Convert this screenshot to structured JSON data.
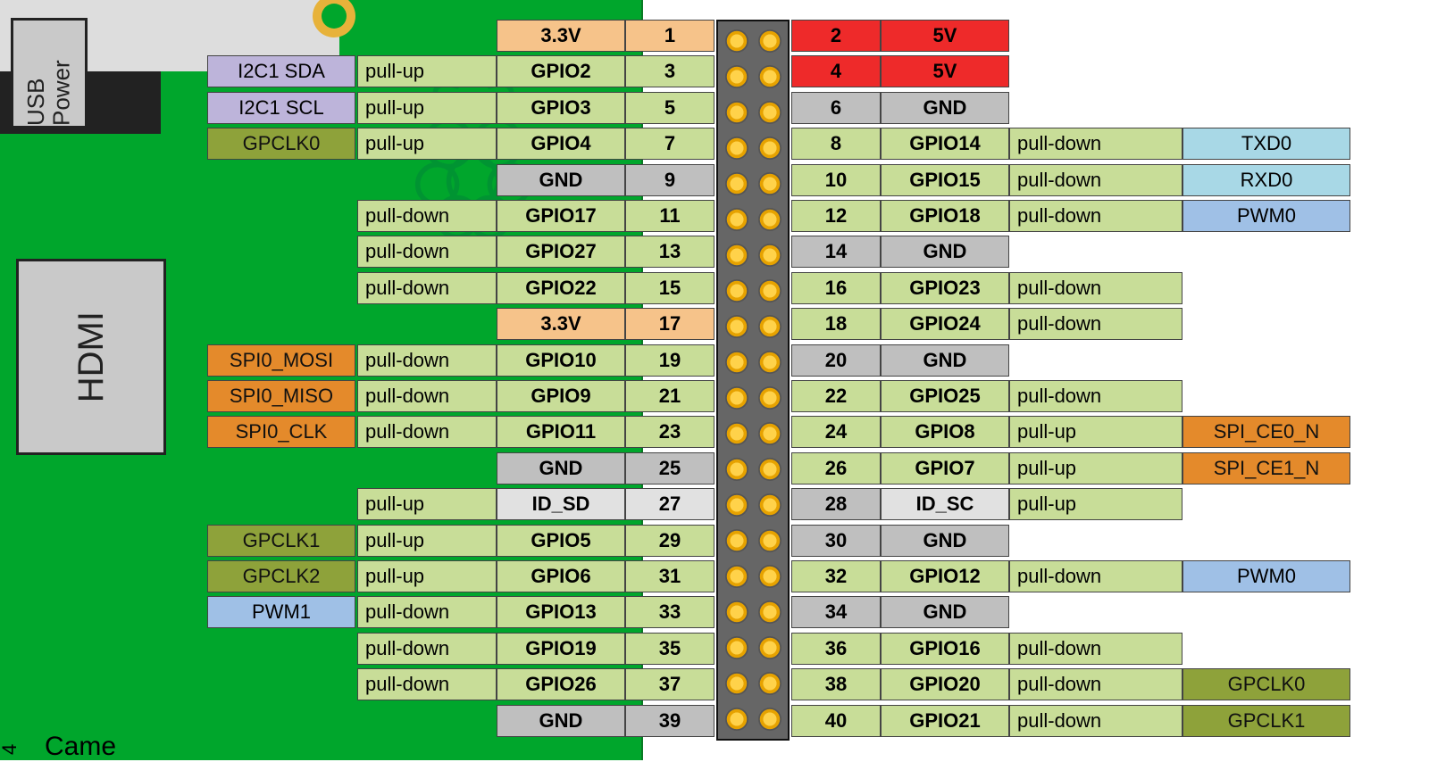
{
  "board": {
    "hdmi": "HDMI",
    "usb_power": "USB\nPower",
    "camera": "Came",
    "page_number": "4"
  },
  "colors": {
    "v33": "c-v33",
    "v5": "c-v5",
    "gnd": "c-gnd",
    "gpio": "c-gpio",
    "pull": "c-pull",
    "id": "c-id",
    "i2c": "c-i2c",
    "spi": "c-spi",
    "uart": "c-uart",
    "pwm": "c-pwm",
    "clk": "c-clk"
  },
  "rows": [
    {
      "l": {
        "num": "1",
        "name": "3.3V",
        "nameCls": "c-v33"
      },
      "r": {
        "num": "2",
        "name": "5V",
        "nameCls": "c-v5",
        "numCls": "c-v5"
      }
    },
    {
      "l": {
        "num": "3",
        "name": "GPIO2",
        "nameCls": "c-gpio",
        "pull": "pull-up",
        "alt": "I2C1 SDA",
        "altCls": "c-i2c"
      },
      "r": {
        "num": "4",
        "name": "5V",
        "nameCls": "c-v5",
        "numCls": "c-v5"
      }
    },
    {
      "l": {
        "num": "5",
        "name": "GPIO3",
        "nameCls": "c-gpio",
        "pull": "pull-up",
        "alt": "I2C1 SCL",
        "altCls": "c-i2c"
      },
      "r": {
        "num": "6",
        "name": "GND",
        "nameCls": "c-gnd",
        "numCls": "c-gnd"
      }
    },
    {
      "l": {
        "num": "7",
        "name": "GPIO4",
        "nameCls": "c-gpio",
        "pull": "pull-up",
        "alt": "GPCLK0",
        "altCls": "c-clk"
      },
      "r": {
        "num": "8",
        "name": "GPIO14",
        "nameCls": "c-gpio",
        "pull": "pull-down",
        "alt": "TXD0",
        "altCls": "c-uart"
      }
    },
    {
      "l": {
        "num": "9",
        "name": "GND",
        "nameCls": "c-gnd",
        "numCls": "c-gnd"
      },
      "r": {
        "num": "10",
        "name": "GPIO15",
        "nameCls": "c-gpio",
        "pull": "pull-down",
        "alt": "RXD0",
        "altCls": "c-uart"
      }
    },
    {
      "l": {
        "num": "11",
        "name": "GPIO17",
        "nameCls": "c-gpio",
        "pull": "pull-down"
      },
      "r": {
        "num": "12",
        "name": "GPIO18",
        "nameCls": "c-gpio",
        "pull": "pull-down",
        "alt": "PWM0",
        "altCls": "c-pwm"
      }
    },
    {
      "l": {
        "num": "13",
        "name": "GPIO27",
        "nameCls": "c-gpio",
        "pull": "pull-down"
      },
      "r": {
        "num": "14",
        "name": "GND",
        "nameCls": "c-gnd",
        "numCls": "c-gnd"
      }
    },
    {
      "l": {
        "num": "15",
        "name": "GPIO22",
        "nameCls": "c-gpio",
        "pull": "pull-down"
      },
      "r": {
        "num": "16",
        "name": "GPIO23",
        "nameCls": "c-gpio",
        "pull": "pull-down"
      }
    },
    {
      "l": {
        "num": "17",
        "name": "3.3V",
        "nameCls": "c-v33"
      },
      "r": {
        "num": "18",
        "name": "GPIO24",
        "nameCls": "c-gpio",
        "pull": "pull-down"
      }
    },
    {
      "l": {
        "num": "19",
        "name": "GPIO10",
        "nameCls": "c-gpio",
        "pull": "pull-down",
        "alt": "SPI0_MOSI",
        "altCls": "c-spi"
      },
      "r": {
        "num": "20",
        "name": "GND",
        "nameCls": "c-gnd",
        "numCls": "c-gnd"
      }
    },
    {
      "l": {
        "num": "21",
        "name": "GPIO9",
        "nameCls": "c-gpio",
        "pull": "pull-down",
        "alt": "SPI0_MISO",
        "altCls": "c-spi"
      },
      "r": {
        "num": "22",
        "name": "GPIO25",
        "nameCls": "c-gpio",
        "pull": "pull-down"
      }
    },
    {
      "l": {
        "num": "23",
        "name": "GPIO11",
        "nameCls": "c-gpio",
        "pull": "pull-down",
        "alt": "SPI0_CLK",
        "altCls": "c-spi"
      },
      "r": {
        "num": "24",
        "name": "GPIO8",
        "nameCls": "c-gpio",
        "pull": "pull-up",
        "alt": "SPI_CE0_N",
        "altCls": "c-spi"
      }
    },
    {
      "l": {
        "num": "25",
        "name": "GND",
        "nameCls": "c-gnd",
        "numCls": "c-gnd"
      },
      "r": {
        "num": "26",
        "name": "GPIO7",
        "nameCls": "c-gpio",
        "pull": "pull-up",
        "alt": "SPI_CE1_N",
        "altCls": "c-spi"
      }
    },
    {
      "l": {
        "num": "27",
        "name": "ID_SD",
        "nameCls": "c-id",
        "pull": "pull-up"
      },
      "r": {
        "num": "28",
        "name": "ID_SC",
        "nameCls": "c-id",
        "numCls": "c-gnd",
        "pull": "pull-up"
      }
    },
    {
      "l": {
        "num": "29",
        "name": "GPIO5",
        "nameCls": "c-gpio",
        "pull": "pull-up",
        "alt": "GPCLK1",
        "altCls": "c-clk"
      },
      "r": {
        "num": "30",
        "name": "GND",
        "nameCls": "c-gnd",
        "numCls": "c-gnd"
      }
    },
    {
      "l": {
        "num": "31",
        "name": "GPIO6",
        "nameCls": "c-gpio",
        "pull": "pull-up",
        "alt": "GPCLK2",
        "altCls": "c-clk"
      },
      "r": {
        "num": "32",
        "name": "GPIO12",
        "nameCls": "c-gpio",
        "pull": "pull-down",
        "alt": "PWM0",
        "altCls": "c-pwm"
      }
    },
    {
      "l": {
        "num": "33",
        "name": "GPIO13",
        "nameCls": "c-gpio",
        "pull": "pull-down",
        "alt": "PWM1",
        "altCls": "c-pwm"
      },
      "r": {
        "num": "34",
        "name": "GND",
        "nameCls": "c-gnd",
        "numCls": "c-gnd"
      }
    },
    {
      "l": {
        "num": "35",
        "name": "GPIO19",
        "nameCls": "c-gpio",
        "pull": "pull-down"
      },
      "r": {
        "num": "36",
        "name": "GPIO16",
        "nameCls": "c-gpio",
        "pull": "pull-down"
      }
    },
    {
      "l": {
        "num": "37",
        "name": "GPIO26",
        "nameCls": "c-gpio",
        "pull": "pull-down"
      },
      "r": {
        "num": "38",
        "name": "GPIO20",
        "nameCls": "c-gpio",
        "pull": "pull-down",
        "alt": "GPCLK0",
        "altCls": "c-clk"
      }
    },
    {
      "l": {
        "num": "39",
        "name": "GND",
        "nameCls": "c-gnd",
        "numCls": "c-gnd"
      },
      "r": {
        "num": "40",
        "name": "GPIO21",
        "nameCls": "c-gpio",
        "pull": "pull-down",
        "alt": "GPCLK1",
        "altCls": "c-clk"
      }
    }
  ]
}
